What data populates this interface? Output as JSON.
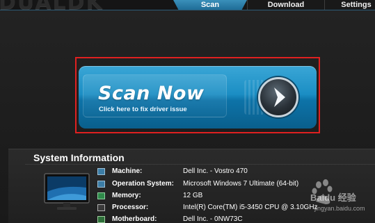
{
  "app": {
    "logo_text": "DUALDK"
  },
  "tabs": [
    {
      "label": "Scan",
      "active": true
    },
    {
      "label": "Download",
      "active": false
    },
    {
      "label": "Settings",
      "active": false
    }
  ],
  "scan_button": {
    "title": "Scan Now",
    "subtitle": "Click here to fix driver issue",
    "icon": "arrow-right-icon"
  },
  "system_info": {
    "title": "System Information",
    "rows": [
      {
        "label": "Machine:",
        "value": "Dell Inc. - Vostro 470",
        "icon": "computer-icon"
      },
      {
        "label": "Operation System:",
        "value": "Microsoft Windows 7 Ultimate  (64-bit)",
        "icon": "os-icon"
      },
      {
        "label": "Memory:",
        "value": "12 GB",
        "icon": "memory-icon"
      },
      {
        "label": "Processor:",
        "value": "Intel(R) Core(TM) i5-3450 CPU @ 3.10GHz",
        "icon": "processor-icon"
      },
      {
        "label": "Motherboard:",
        "value": "Dell Inc. - 0NW73C",
        "icon": "motherboard-icon"
      }
    ]
  },
  "watermark": {
    "brand": "Baidu 经验",
    "url": "jingyan.baidu.com"
  },
  "colors": {
    "accent": "#1b8ec4",
    "highlight": "#e02020",
    "background": "#1c1c1c"
  }
}
